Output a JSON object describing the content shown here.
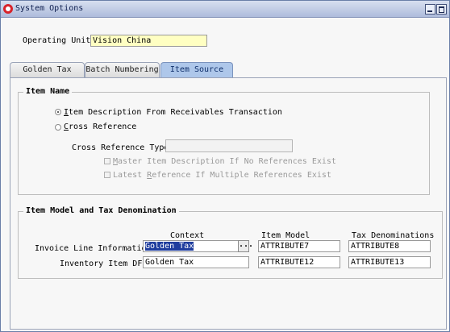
{
  "window": {
    "title": "System Options"
  },
  "operating_unit": {
    "label": "Operating Unit",
    "value": "Vision China"
  },
  "tabs": [
    {
      "label": "Golden Tax"
    },
    {
      "label": "Batch Numbering"
    },
    {
      "label": "Item Source"
    }
  ],
  "item_name": {
    "title": "Item Name",
    "radio_item_description": {
      "prefix": "",
      "underline": "I",
      "rest": "tem Description From Receivables Transaction"
    },
    "radio_cross_reference": {
      "underline": "C",
      "rest": "ross Reference"
    },
    "cross_reference_type_label": "Cross Reference Type",
    "cross_reference_type_value": "",
    "check_master": {
      "underline": "M",
      "rest": "aster Item Description If No References Exist"
    },
    "check_latest": {
      "prefix": "Latest ",
      "underline": "R",
      "rest": "eference If Multiple References Exist"
    }
  },
  "item_model": {
    "title": "Item Model and Tax Denomination",
    "headers": {
      "context": "Context",
      "item_model": "Item Model",
      "tax_denominations": "Tax Denominations"
    },
    "rows": [
      {
        "label": "Invoice Line Information",
        "context": "Golden Tax",
        "item_model": "ATTRIBUTE7",
        "tax_denomination": "ATTRIBUTE8"
      },
      {
        "label": "Inventory Item DFF",
        "context": "Golden Tax",
        "item_model": "ATTRIBUTE12",
        "tax_denomination": "ATTRIBUTE13"
      }
    ],
    "ellipsis": "..."
  }
}
